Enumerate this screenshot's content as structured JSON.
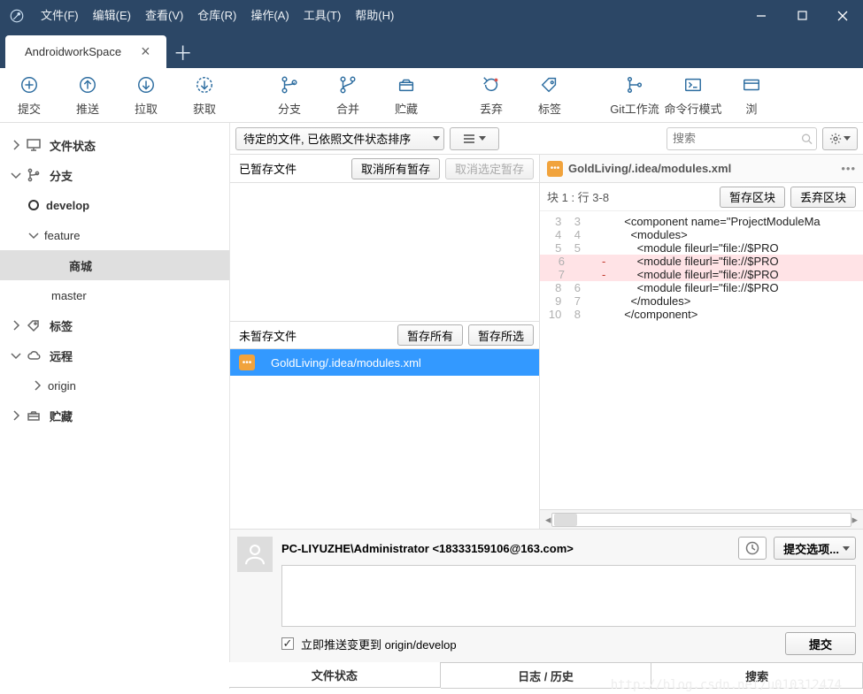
{
  "menu": {
    "file": "文件(F)",
    "edit": "编辑(E)",
    "view": "查看(V)",
    "repo": "仓库(R)",
    "actions": "操作(A)",
    "tools": "工具(T)",
    "help": "帮助(H)"
  },
  "tab": {
    "title": "AndroidworkSpace"
  },
  "toolbar": {
    "commit": "提交",
    "push": "推送",
    "pull": "拉取",
    "fetch": "获取",
    "branch": "分支",
    "merge": "合并",
    "stash": "贮藏",
    "discard": "丢弃",
    "tag": "标签",
    "gitflow": "Git工作流",
    "cmd": "命令行模式",
    "browse": "浏"
  },
  "sidebar": {
    "fileStatus": "文件状态",
    "branches": "分支",
    "develop": "develop",
    "feature": "feature",
    "mall": "商城",
    "master": "master",
    "tags": "标签",
    "remotes": "远程",
    "origin": "origin",
    "stashes": "贮藏"
  },
  "filter": {
    "pending": "待定的文件, 已依照文件状态排序"
  },
  "search": {
    "placeholder": "搜索"
  },
  "staged": {
    "title": "已暂存文件",
    "unstageAll": "取消所有暂存",
    "unstageSel": "取消选定暂存"
  },
  "unstaged": {
    "title": "未暂存文件",
    "stageAll": "暂存所有",
    "stageSel": "暂存所选",
    "file": "GoldLiving/.idea/modules.xml"
  },
  "diff": {
    "filename": "GoldLiving/.idea/modules.xml",
    "hunk": "块 1 : 行 3-8",
    "stageHunk": "暂存区块",
    "discardHunk": "丢弃区块",
    "lines": [
      {
        "ol": "3",
        "nl": "3",
        "t": "  <component name=\"ProjectModuleMa",
        "c": ""
      },
      {
        "ol": "4",
        "nl": "4",
        "t": "    <modules>",
        "c": ""
      },
      {
        "ol": "5",
        "nl": "5",
        "t": "      <module fileurl=\"file://$PRO",
        "c": ""
      },
      {
        "ol": "6",
        "nl": "",
        "t": "      <module fileurl=\"file://$PRO",
        "c": "removed",
        "m": "-"
      },
      {
        "ol": "7",
        "nl": "",
        "t": "      <module fileurl=\"file://$PRO",
        "c": "removed",
        "m": "-"
      },
      {
        "ol": "8",
        "nl": "6",
        "t": "      <module fileurl=\"file://$PRO",
        "c": ""
      },
      {
        "ol": "9",
        "nl": "7",
        "t": "    </modules>",
        "c": ""
      },
      {
        "ol": "10",
        "nl": "8",
        "t": "  </component>",
        "c": ""
      }
    ]
  },
  "commit": {
    "author": "PC-LIYUZHE\\Administrator <18333159106@163.com>",
    "options": "提交选项...",
    "pushCheckbox": "立即推送变更到 origin/develop",
    "submit": "提交"
  },
  "bottomTabs": {
    "files": "文件状态",
    "log": "日志 / 历史",
    "search": "搜索"
  },
  "watermark": "http://blog.csdn.net/u010312474"
}
